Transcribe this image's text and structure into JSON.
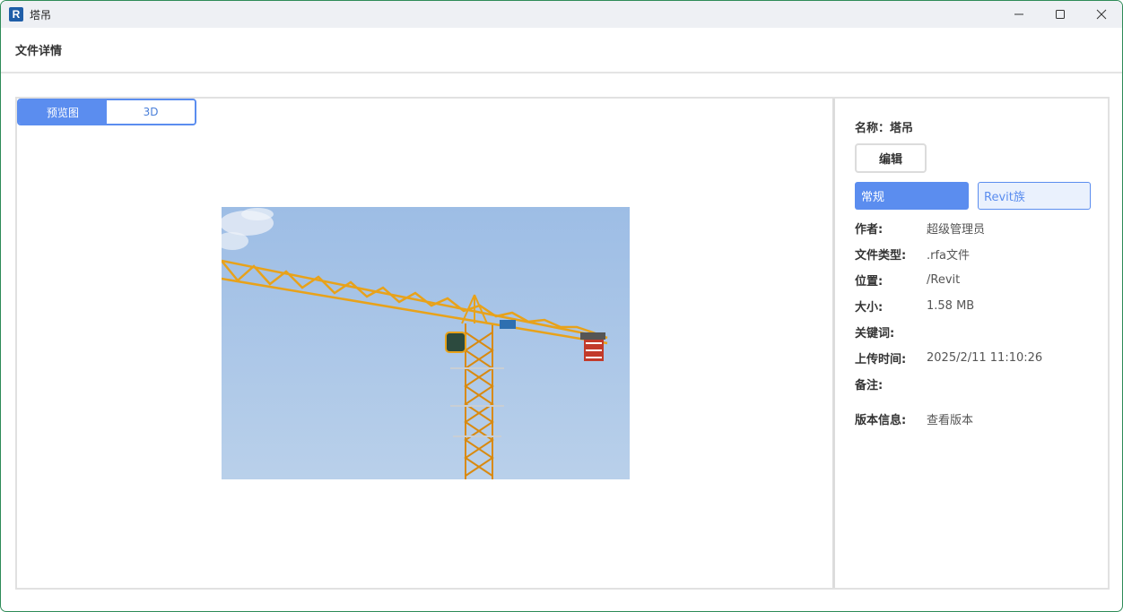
{
  "window": {
    "title": "塔吊",
    "app_icon_letter": "R"
  },
  "header": {
    "title": "文件详情"
  },
  "tabs": [
    {
      "label": "预览图",
      "active": true
    },
    {
      "label": "3D",
      "active": false
    }
  ],
  "details": {
    "name_label": "名称：",
    "name_value": "塔吊",
    "edit_label": "编辑",
    "segment_general": "常规",
    "segment_revit": "Revit族",
    "rows": [
      {
        "label": "作者:",
        "value": "超级管理员"
      },
      {
        "label": "文件类型:",
        "value": ".rfa文件"
      },
      {
        "label": "位置:",
        "value": "/Revit"
      },
      {
        "label": "大小:",
        "value": "1.58 MB"
      },
      {
        "label": "关键词:",
        "value": ""
      },
      {
        "label": "上传时间:",
        "value": "2025/2/11 11:10:26"
      },
      {
        "label": "备注:",
        "value": ""
      }
    ],
    "version_label": "版本信息:",
    "version_link": "查看版本"
  },
  "colors": {
    "accent": "#5b8def",
    "window_border": "#2e8b57",
    "crane": "#e8a21a",
    "sky": "#a9c6e8"
  }
}
